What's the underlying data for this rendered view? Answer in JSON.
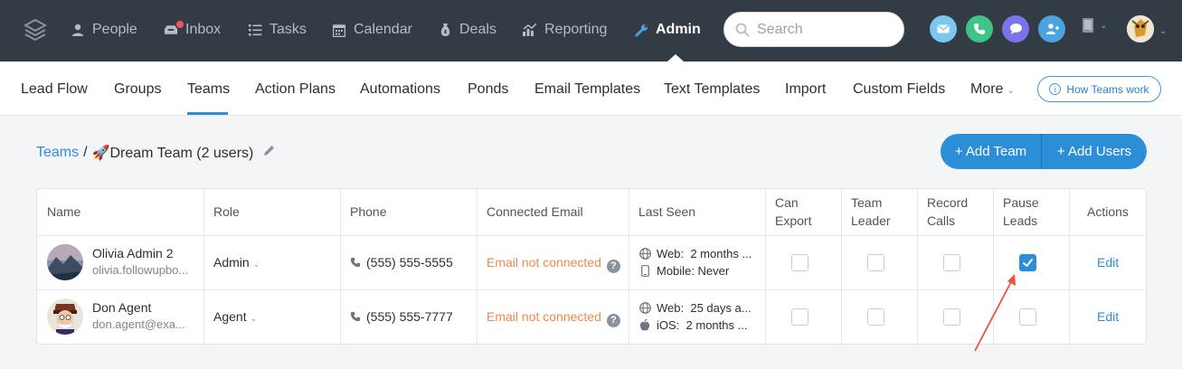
{
  "nav": {
    "items": [
      {
        "label": "People",
        "icon": "person-icon"
      },
      {
        "label": "Inbox",
        "icon": "inbox-icon"
      },
      {
        "label": "Tasks",
        "icon": "list-icon"
      },
      {
        "label": "Calendar",
        "icon": "calendar-icon"
      },
      {
        "label": "Deals",
        "icon": "money-bag-icon"
      },
      {
        "label": "Reporting",
        "icon": "chart-icon"
      },
      {
        "label": "Admin",
        "icon": "wrench-icon"
      }
    ],
    "search_placeholder": "Search",
    "accent": "#4ba3e0"
  },
  "subnav": {
    "items": [
      "Lead Flow",
      "Groups",
      "Teams",
      "Action Plans",
      "Automations",
      "Ponds",
      "Email Templates",
      "Text Templates",
      "Import",
      "Custom Fields",
      "More"
    ],
    "how_to": "How Teams work"
  },
  "breadcrumb": {
    "root": "Teams",
    "sep": "/",
    "current": "🚀Dream Team (2 users)"
  },
  "buttons": {
    "add_team": "+ Add Team",
    "add_users": "+ Add Users"
  },
  "table": {
    "headers": {
      "name": "Name",
      "role": "Role",
      "phone": "Phone",
      "email": "Connected Email",
      "last_seen": "Last Seen",
      "can_export_1": "Can",
      "can_export_2": "Export",
      "team_leader_1": "Team",
      "team_leader_2": "Leader",
      "record_calls_1": "Record",
      "record_calls_2": "Calls",
      "pause_leads_1": "Pause",
      "pause_leads_2": "Leads",
      "actions": "Actions"
    },
    "rows": [
      {
        "name": "Olivia Admin 2",
        "email_addr": "olivia.followupbo...",
        "role": "Admin",
        "phone": "(555) 555-5555",
        "connected": "Email not connected",
        "seen1_label": "Web:",
        "seen1_value": "2 months ...",
        "seen2_label": "Mobile:",
        "seen2_value": "Never",
        "can_export": false,
        "team_leader": false,
        "record_calls": false,
        "pause_leads": true,
        "action": "Edit"
      },
      {
        "name": "Don Agent",
        "email_addr": "don.agent@exa...",
        "role": "Agent",
        "phone": "(555) 555-7777",
        "connected": "Email not connected",
        "seen1_label": "Web:",
        "seen1_value": "25 days a...",
        "seen2_label": "iOS:",
        "seen2_value": "2 months ...",
        "can_export": false,
        "team_leader": false,
        "record_calls": false,
        "pause_leads": false,
        "action": "Edit"
      }
    ]
  },
  "colors": {
    "topbar": "#333b45",
    "primary": "#2d8ed8",
    "warning_text": "#f0884f",
    "annotation_arrow": "#e8533a"
  }
}
